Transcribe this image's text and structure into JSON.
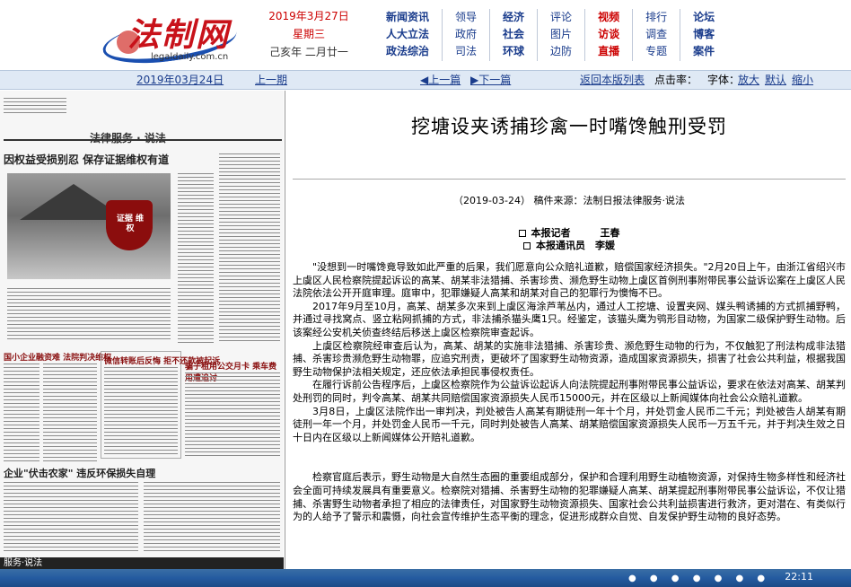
{
  "header": {
    "logo_text": "法制网",
    "logo_url": "legaldaily.com.cn",
    "date_cn": "2019年3月27日",
    "weekday": "星期三",
    "lunar": "己亥年 二月廿一"
  },
  "nav": [
    {
      "items": [
        "新闻资讯",
        "人大立法",
        "政法综治"
      ],
      "style": "b"
    },
    {
      "items": [
        "领导",
        "政府",
        "司法"
      ],
      "style": ""
    },
    {
      "items": [
        "经济",
        "社会",
        "环球"
      ],
      "style": "b"
    },
    {
      "items": [
        "评论",
        "图片",
        "边防"
      ],
      "style": ""
    },
    {
      "items": [
        "视频",
        "访谈",
        "直播"
      ],
      "style": "r"
    },
    {
      "items": [
        "排行",
        "调查",
        "专题"
      ],
      "style": ""
    },
    {
      "items": [
        "论坛",
        "博客",
        "案件"
      ],
      "style": "b"
    }
  ],
  "toolbar": {
    "issue_date": "2019年03月24日",
    "prev_issue": "上一期",
    "prev_page": "◀上一篇",
    "next_page": "▶下一篇",
    "back_to_list": "返回本版列表",
    "hits_label": "点击率：",
    "font_label": "字体：",
    "font_larger": "放大",
    "font_default": "默认",
    "font_smaller": "缩小"
  },
  "paper": {
    "masthead": "法律服务 · 说法",
    "headline": "因权益受损别忍  保存证据维权有道",
    "shield": "证据 维权",
    "sub1": "国小企业融资难 法院判决维权",
    "sub2": "微信转账后反悔 拒不还款被起诉",
    "sub3": "骗子租用公交月卡 乘车费用遭追讨",
    "bottom_head": "企业\"伏击农家\"  违反环保损失自理",
    "strip": "服务·说法"
  },
  "article": {
    "title": "挖塘设夹诱捕珍禽一时嘴馋触刑受罚",
    "meta": "（2019-03-24） 稿件来源：法制日报法律服务·说法",
    "byline1": "本报记者　　　王春",
    "byline2": "本报通讯员　李媛",
    "paragraphs": [
      "\"没想到一时嘴馋竟导致如此严重的后果，我们愿意向公众赔礼道歉，赔偿国家经济损失。\"2月20日上午，由浙江省绍兴市上虞区人民检察院提起诉讼的高某、胡某非法猎捕、杀害珍贵、濒危野生动物上虞区首例刑事附带民事公益诉讼案在上虞区人民法院依法公开开庭审理。庭审中，犯罪嫌疑人高某和胡某对自己的犯罪行为懊悔不已。",
      "2017年9月至10月，高某、胡某多次来到上虞区海涂芦苇丛内，通过人工挖塘、设置夹网、媒头鸭诱捕的方式抓捕野鸭，并通过寻找窝点、竖立粘网抓捕的方式，非法捕杀猫头鹰1只。经鉴定，该猫头鹰为鸮形目动物，为国家二级保护野生动物。后该案经公安机关侦查终结后移送上虞区检察院审查起诉。",
      "上虞区检察院经审查后认为，高某、胡某的实施非法猎捕、杀害珍贵、濒危野生动物的行为，不仅触犯了刑法构成非法猎捕、杀害珍贵濒危野生动物罪，应追究刑责，更破坏了国家野生动物资源，造成国家资源损失，损害了社会公共利益，根据我国野生动物保护法相关规定，还应依法承担民事侵权责任。",
      "在履行诉前公告程序后，上虞区检察院作为公益诉讼起诉人向法院提起刑事附带民事公益诉讼，要求在依法对高某、胡某判处刑罚的同时，判令高某、胡某共同赔偿国家资源损失人民币15000元，并在区级以上新闻媒体向社会公众赔礼道歉。",
      "3月8日，上虞区法院作出一审判决，判处被告人高某有期徒刑一年十个月，并处罚金人民币二千元；判处被告人胡某有期徒刑一年一个月，并处罚金人民币一千元，同时判处被告人高某、胡某赔偿国家资源损失人民币一万五千元，并于判决生效之日十日内在区级以上新闻媒体公开赔礼道歉。",
      "检察官庭后表示，野生动物是大自然生态圈的重要组成部分，保护和合理利用野生动植物资源，对保持生物多样性和经济社会全面可持续发展具有重要意义。检察院对猎捕、杀害野生动物的犯罪嫌疑人高某、胡某提起刑事附带民事公益诉讼，不仅让猎捕、杀害野生动物者承担了相应的法律责任，对国家野生动物资源损失、国家社会公共利益损害进行救济，更对潜在、有类似行为的人给予了警示和震慑，向社会宣传维护生态平衡的理念，促进形成群众自觉、自发保护野生动物的良好态势。"
    ]
  },
  "taskbar": {
    "clock": "22:11"
  }
}
